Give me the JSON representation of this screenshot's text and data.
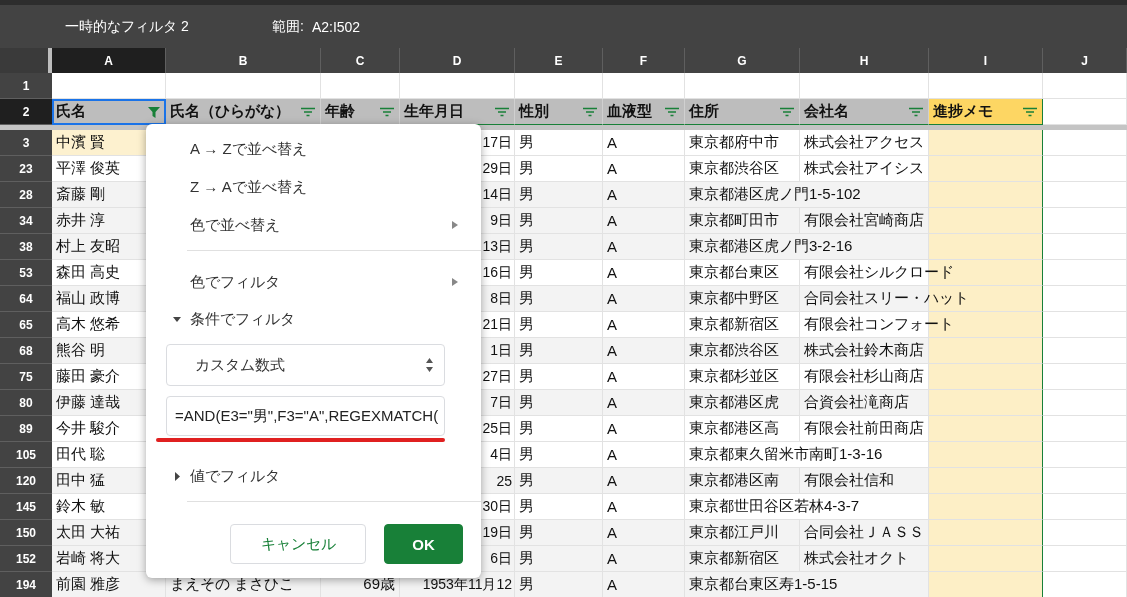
{
  "filter_bar": {
    "title": "一時的なフィルタ 2",
    "range_label": "範囲:",
    "range": "A2:I502"
  },
  "columns": [
    {
      "letter": "A",
      "selected": true
    },
    {
      "letter": "B",
      "selected": false
    },
    {
      "letter": "C",
      "selected": false
    },
    {
      "letter": "D",
      "selected": false
    },
    {
      "letter": "E",
      "selected": false
    },
    {
      "letter": "F",
      "selected": false
    },
    {
      "letter": "G",
      "selected": false
    },
    {
      "letter": "H",
      "selected": false
    },
    {
      "letter": "I",
      "selected": false
    },
    {
      "letter": "J",
      "selected": false
    }
  ],
  "header_rows": [
    {
      "number": "1",
      "selected": false
    },
    {
      "number": "2",
      "selected": true
    }
  ],
  "filter_headers": [
    {
      "label": "氏名",
      "filtered": true,
      "highlighted": false
    },
    {
      "label": "氏名（ひらがな）",
      "filtered": false,
      "highlighted": false
    },
    {
      "label": "年齢",
      "filtered": false,
      "highlighted": false
    },
    {
      "label": "生年月日",
      "filtered": false,
      "highlighted": false
    },
    {
      "label": "性別",
      "filtered": false,
      "highlighted": false
    },
    {
      "label": "血液型",
      "filtered": false,
      "highlighted": false
    },
    {
      "label": "住所",
      "filtered": false,
      "highlighted": false
    },
    {
      "label": "会社名",
      "filtered": false,
      "highlighted": false
    },
    {
      "label": "進捗メモ",
      "filtered": false,
      "highlighted": true
    }
  ],
  "rows": [
    {
      "number": "3",
      "banded": false,
      "highlighted": true,
      "name": "中濱 賢",
      "birth_date": "17日",
      "gender": "男",
      "blood_type": "A",
      "address": "東京都府中市",
      "company": "株式会社アクセス"
    },
    {
      "number": "23",
      "banded": false,
      "highlighted": false,
      "name": "平澤 俊英",
      "birth_date": "29日",
      "gender": "男",
      "blood_type": "A",
      "address": "東京都渋谷区",
      "company": "株式会社アイシス"
    },
    {
      "number": "28",
      "banded": true,
      "highlighted": false,
      "name": "斎藤 剛",
      "birth_date": "14日",
      "gender": "男",
      "blood_type": "A",
      "address": "東京都港区虎ノ門1-5-102"
    },
    {
      "number": "34",
      "banded": true,
      "highlighted": false,
      "name": "赤井 淳",
      "birth_date": "9日",
      "gender": "男",
      "blood_type": "A",
      "address": "東京都町田市",
      "company": "有限会社宮崎商店"
    },
    {
      "number": "38",
      "banded": true,
      "highlighted": false,
      "name": "村上 友昭",
      "birth_date": "13日",
      "gender": "男",
      "blood_type": "A",
      "address": "東京都港区虎ノ門3-2-16"
    },
    {
      "number": "53",
      "banded": false,
      "highlighted": false,
      "name": "森田 高史",
      "birth_date": "16日",
      "gender": "男",
      "blood_type": "A",
      "address": "東京都台東区",
      "company": "有限会社シルクロード"
    },
    {
      "number": "64",
      "banded": true,
      "highlighted": false,
      "name": "福山 政博",
      "birth_date": "8日",
      "gender": "男",
      "blood_type": "A",
      "address": "東京都中野区",
      "company": "合同会社スリー・ハット"
    },
    {
      "number": "65",
      "banded": false,
      "highlighted": false,
      "name": "高木 悠希",
      "birth_date": "21日",
      "gender": "男",
      "blood_type": "A",
      "address": "東京都新宿区",
      "company": "有限会社コンフォート"
    },
    {
      "number": "68",
      "banded": true,
      "highlighted": false,
      "name": "熊谷 明",
      "birth_date": "1日",
      "gender": "男",
      "blood_type": "A",
      "address": "東京都渋谷区",
      "company": "株式会社鈴木商店"
    },
    {
      "number": "75",
      "banded": false,
      "highlighted": false,
      "name": "藤田 豪介",
      "birth_date": "27日",
      "gender": "男",
      "blood_type": "A",
      "address": "東京都杉並区",
      "company": "有限会社杉山商店"
    },
    {
      "number": "80",
      "banded": true,
      "highlighted": false,
      "name": "伊藤 達哉",
      "birth_date": "7日",
      "gender": "男",
      "blood_type": "A",
      "address": "東京都港区虎",
      "company": "合資会社滝商店"
    },
    {
      "number": "89",
      "banded": false,
      "highlighted": false,
      "name": "今井 駿介",
      "birth_date": "25日",
      "gender": "男",
      "blood_type": "A",
      "address": "東京都港区高",
      "company": "有限会社前田商店"
    },
    {
      "number": "105",
      "banded": false,
      "highlighted": false,
      "name": "田代 聡",
      "birth_date": "4日",
      "gender": "男",
      "blood_type": "A",
      "address": "東京都東久留米市南町1-3-16"
    },
    {
      "number": "120",
      "banded": true,
      "highlighted": false,
      "name": "田中 猛",
      "birth_date": "25",
      "gender": "男",
      "blood_type": "A",
      "address": "東京都港区南",
      "company": "有限会社信和"
    },
    {
      "number": "145",
      "banded": false,
      "highlighted": false,
      "name": "鈴木 敏",
      "birth_date": "30日",
      "gender": "男",
      "blood_type": "A",
      "address": "東京都世田谷区若林4-3-7"
    },
    {
      "number": "150",
      "banded": true,
      "highlighted": false,
      "name": "太田 大祐",
      "birth_date": "19日",
      "gender": "男",
      "blood_type": "A",
      "address": "東京都江戸川",
      "company": "合同会社ＪＡＳＳ"
    },
    {
      "number": "152",
      "banded": true,
      "highlighted": false,
      "name": "岩崎 将大",
      "birth_date": "6日",
      "gender": "男",
      "blood_type": "A",
      "address": "東京都新宿区",
      "company": "株式会社オクト"
    },
    {
      "number": "194",
      "banded": true,
      "highlighted": false,
      "name": "前園 雅彦",
      "kana": "まえその まさひこ",
      "age": "69歳",
      "birth_date": "1953年11月12",
      "gender": "男",
      "blood_type": "A",
      "address": "東京都台東区寿1-5-15"
    }
  ],
  "menu": {
    "items": [
      {
        "kind": "action",
        "label": "A → Zで並べ替え"
      },
      {
        "kind": "action",
        "label": "Z → Aで並べ替え"
      },
      {
        "kind": "submenu",
        "label": "色で並べ替え"
      },
      {
        "kind": "divider"
      },
      {
        "kind": "submenu",
        "label": "色でフィルタ"
      },
      {
        "kind": "section",
        "label": "条件でフィルタ",
        "expanded": true
      },
      {
        "kind": "select",
        "value": "カスタム数式"
      },
      {
        "kind": "input",
        "value": "=AND(E3=\"男\",F3=\"A\",REGEXMATCH(",
        "annotated": true
      },
      {
        "kind": "section",
        "label": "値でフィルタ",
        "expanded": false
      },
      {
        "kind": "divider"
      }
    ],
    "buttons": [
      {
        "label": "キャンセル",
        "primary": false
      },
      {
        "label": "OK",
        "primary": true
      }
    ]
  }
}
